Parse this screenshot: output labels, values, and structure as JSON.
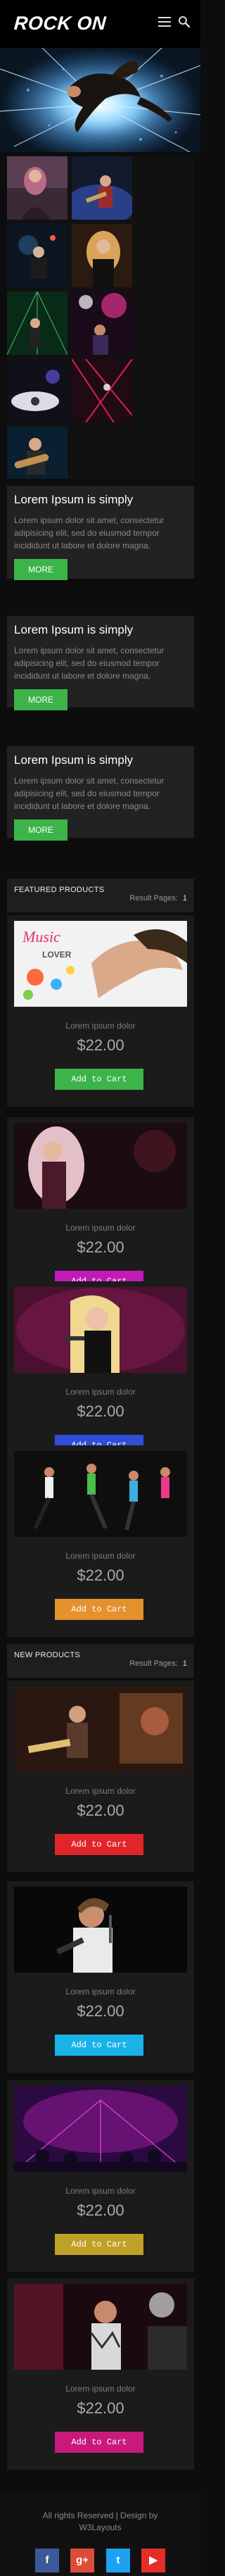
{
  "header": {
    "logo": "ROCK ON"
  },
  "blocks": [
    {
      "title": "Lorem Ipsum is simply",
      "text": "Lorem ipsum dolor sit amet, consectetur adipisicing elit, sed do eiusmod tempor incididunt ut labore et dolore magna.",
      "button": "MORE"
    },
    {
      "title": "Lorem Ipsum is simply",
      "text": "Lorem ipsum dolor sit amet, consectetur adipisicing elit, sed do eiusmod tempor incididunt ut labore et dolore magna.",
      "button": "MORE"
    },
    {
      "title": "Lorem Ipsum is simply",
      "text": "Lorem ipsum dolor sit amet, consectetur adipisicing elit, sed do eiusmod tempor incididunt ut labore et dolore magna.",
      "button": "MORE"
    }
  ],
  "featured": {
    "title": "FEATURED PRODUCTS",
    "result_label": "Result Pages:",
    "page": "1",
    "products": [
      {
        "name": "Lorem ipsum dolor",
        "price": "$22.00",
        "button": "Add to Cart",
        "button_color": "#3cb44a"
      },
      {
        "name": "Lorem ipsum dolor",
        "price": "$22.00",
        "button": "Add to Cart",
        "button_color": "#c21ab5"
      },
      {
        "name": "Lorem ipsum dolor",
        "price": "$22.00",
        "button": "Add to Cart",
        "button_color": "#2f4fd6"
      },
      {
        "name": "Lorem ipsum dolor",
        "price": "$22.00",
        "button": "Add to Cart",
        "button_color": "#e5912e"
      }
    ]
  },
  "new_products": {
    "title": "NEW PRODUCTS",
    "result_label": "Result Pages:",
    "page": "1",
    "products": [
      {
        "name": "Lorem ipsum dolor",
        "price": "$22.00",
        "button": "Add to Cart",
        "button_color": "#e0262b"
      },
      {
        "name": "Lorem ipsum dolor",
        "price": "$22.00",
        "button": "Add to Cart",
        "button_color": "#1ab3e8"
      },
      {
        "name": "Lorem ipsum dolor",
        "price": "$22.00",
        "button": "Add to Cart",
        "button_color": "#bfa125"
      },
      {
        "name": "Lorem ipsum dolor",
        "price": "$22.00",
        "button": "Add to Cart",
        "button_color": "#c9197c"
      }
    ]
  },
  "footer": {
    "copyright": "All rights Reserved | Design by",
    "designer": "W3Layouts",
    "social": [
      {
        "icon": "facebook-icon",
        "glyph": "f",
        "color": "#3b5998"
      },
      {
        "icon": "google-plus-icon",
        "glyph": "g+",
        "color": "#dd4b39"
      },
      {
        "icon": "twitter-icon",
        "glyph": "t",
        "color": "#1da1f2"
      },
      {
        "icon": "youtube-icon",
        "glyph": "▶",
        "color": "#e52d27"
      }
    ]
  }
}
